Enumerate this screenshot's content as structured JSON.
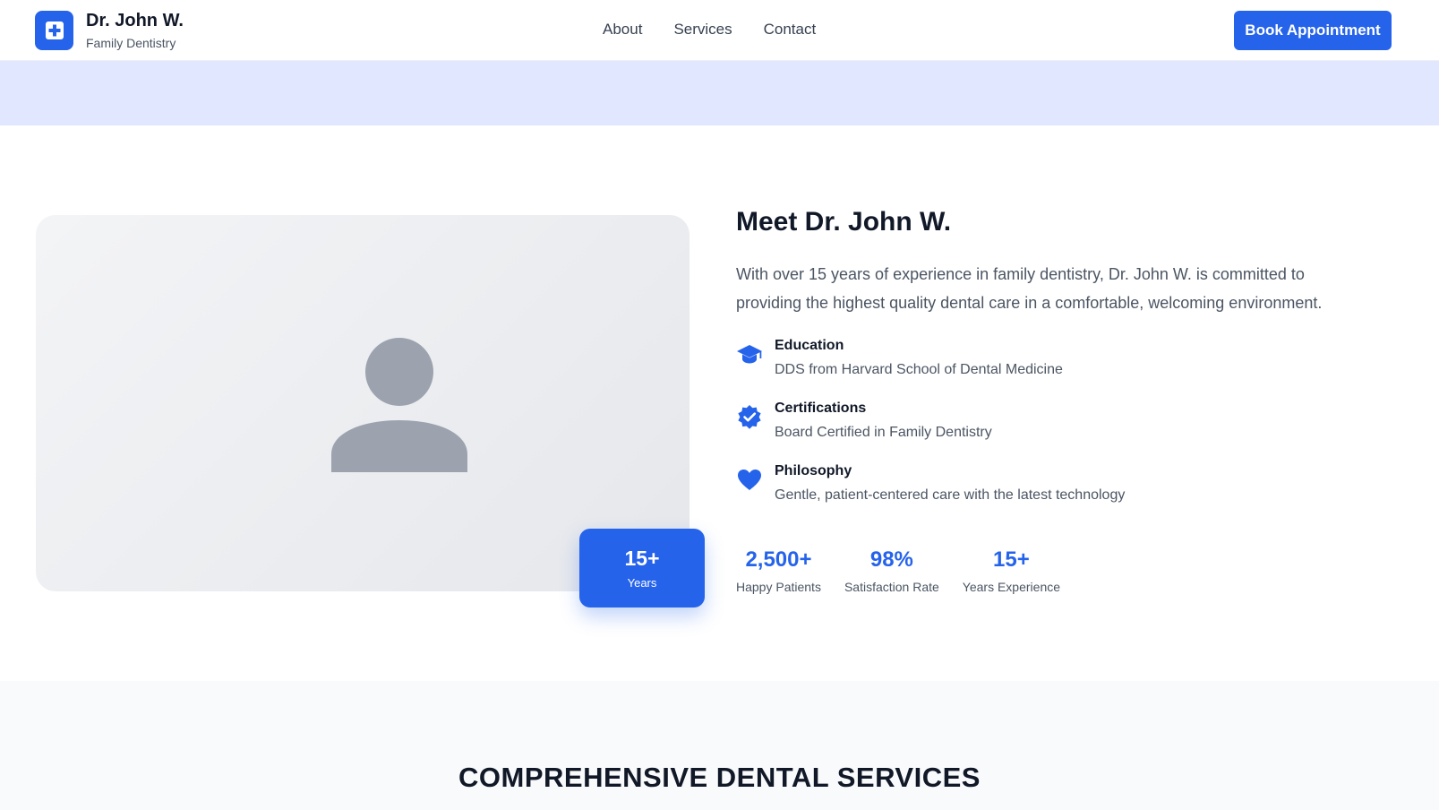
{
  "brand": {
    "name": "Dr. John W.",
    "subtitle": "Family Dentistry"
  },
  "nav": {
    "items": [
      "About",
      "Services",
      "Contact"
    ]
  },
  "header": {
    "cta_label": "Book Appointment"
  },
  "badge": {
    "value": "15+",
    "label": "Years"
  },
  "about": {
    "title": "Meet Dr. John W.",
    "intro": "With over 15 years of experience in family dentistry, Dr. John W. is committed to providing the highest quality dental care in a comfortable, welcoming environment.",
    "features": [
      {
        "icon": "graduation-cap-icon",
        "title": "Education",
        "desc": "DDS from Harvard School of Dental Medicine"
      },
      {
        "icon": "badge-check-icon",
        "title": "Certifications",
        "desc": "Board Certified in Family Dentistry"
      },
      {
        "icon": "heart-icon",
        "title": "Philosophy",
        "desc": "Gentle, patient-centered care with the latest technology"
      }
    ],
    "stats": [
      {
        "value": "2,500+",
        "label": "Happy Patients"
      },
      {
        "value": "98%",
        "label": "Satisfaction Rate"
      },
      {
        "value": "15+",
        "label": "Years Experience"
      }
    ]
  },
  "services": {
    "heading": "COMPREHENSIVE DENTAL SERVICES"
  },
  "colors": {
    "accent": "#2563eb",
    "band": "#e0e7ff"
  }
}
